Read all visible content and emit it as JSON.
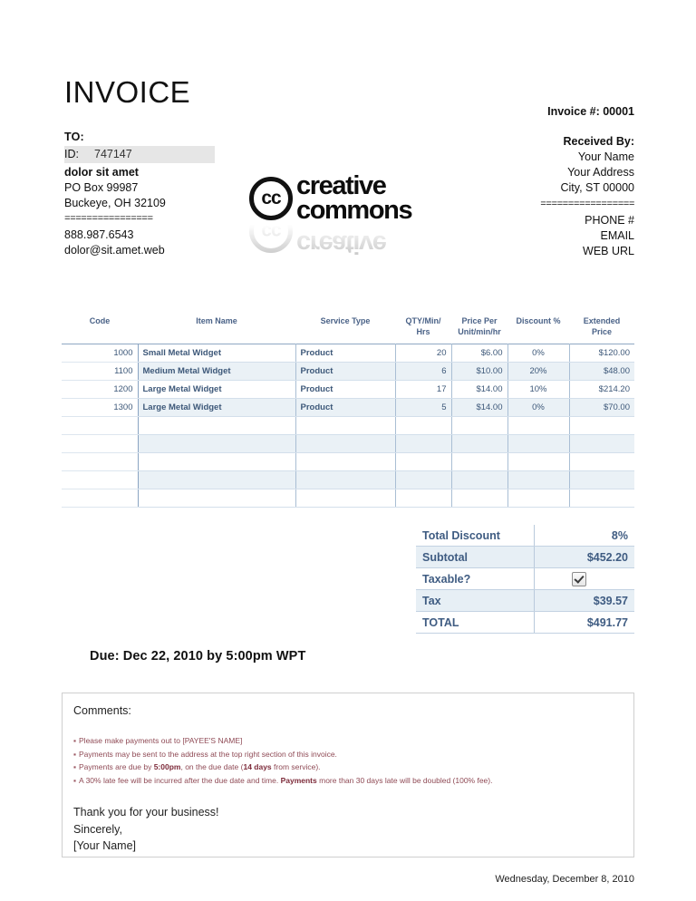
{
  "document": {
    "title": "INVOICE"
  },
  "bill_to": {
    "label": "TO:",
    "id_key": "ID:",
    "id_value": "747147",
    "name": "dolor sit amet",
    "address_line": "PO Box 99987",
    "city_state_zip": "Buckeye, OH 32109",
    "separator": "================",
    "phone": "888.987.6543",
    "email": "dolor@sit.amet.web"
  },
  "logo": {
    "badge_text": "cc",
    "line1": "creative",
    "line2": "commons"
  },
  "received_by": {
    "invoice_number_label": "Invoice #: 00001",
    "label": "Received By:",
    "name": "Your Name",
    "address": "Your Address",
    "city_state_zip": "City, ST 00000",
    "separator": "=================",
    "phone": "PHONE #",
    "email": "EMAIL",
    "web": "WEB URL"
  },
  "items_table": {
    "headers": {
      "code": "Code",
      "item_name": "Item Name",
      "service_type": "Service Type",
      "qty": "QTY/Min/ Hrs",
      "qty_l1": "QTY/Min/",
      "qty_l2": "Hrs",
      "price_l1": "Price Per",
      "price_l2": "Unit/min/hr",
      "discount": "Discount %",
      "extended_l1": "Extended",
      "extended_l2": "Price"
    },
    "rows": [
      {
        "code": "1000",
        "name": "Small Metal Widget",
        "type": "Product",
        "qty": "20",
        "price": "$6.00",
        "discount": "0%",
        "extended": "$120.00"
      },
      {
        "code": "1100",
        "name": "Medium Metal Widget",
        "type": "Product",
        "qty": "6",
        "price": "$10.00",
        "discount": "20%",
        "extended": "$48.00"
      },
      {
        "code": "1200",
        "name": "Large Metal Widget",
        "type": "Product",
        "qty": "17",
        "price": "$14.00",
        "discount": "10%",
        "extended": "$214.20"
      },
      {
        "code": "1300",
        "name": "Large Metal Widget",
        "type": "Product",
        "qty": "5",
        "price": "$14.00",
        "discount": "0%",
        "extended": "$70.00"
      },
      {
        "code": "",
        "name": "",
        "type": "",
        "qty": "",
        "price": "",
        "discount": "",
        "extended": ""
      },
      {
        "code": "",
        "name": "",
        "type": "",
        "qty": "",
        "price": "",
        "discount": "",
        "extended": ""
      },
      {
        "code": "",
        "name": "",
        "type": "",
        "qty": "",
        "price": "",
        "discount": "",
        "extended": ""
      },
      {
        "code": "",
        "name": "",
        "type": "",
        "qty": "",
        "price": "",
        "discount": "",
        "extended": ""
      },
      {
        "code": "",
        "name": "",
        "type": "",
        "qty": "",
        "price": "",
        "discount": "",
        "extended": ""
      }
    ]
  },
  "totals": {
    "total_discount_label": "Total Discount",
    "total_discount_value": "8%",
    "subtotal_label": "Subtotal",
    "subtotal_value": "$452.20",
    "taxable_label": "Taxable?",
    "taxable_checked": true,
    "tax_label": "Tax",
    "tax_value": "$39.57",
    "total_label": "TOTAL",
    "total_value": "$491.77"
  },
  "due": {
    "text": "Due: Dec 22, 2010 by 5:00pm WPT"
  },
  "comments": {
    "label": "Comments:",
    "bullet": "▪",
    "notes": [
      {
        "pre": "Please make payments out to [PAYEE'S NAME]",
        "bold": "",
        "post": ""
      },
      {
        "pre": "Payments may be sent to the address at the top right section of this invoice.",
        "bold": "",
        "post": ""
      },
      {
        "pre": "Payments are due by ",
        "bold": "5:00pm",
        "post": ", on the due date (",
        "bold2": "14 days",
        "post2": " from service)."
      },
      {
        "pre": "A 30% late fee will be incurred after the due date and time. ",
        "bold": "Payments",
        "post": " more than 30 days late will be doubled (100% fee)."
      }
    ],
    "thanks": "Thank you for your business!",
    "sincerely": "Sincerely,",
    "signature": "[Your Name]"
  },
  "footer": {
    "date": "Wednesday, December 8, 2010"
  },
  "colors": {
    "table_text": "#3d5879",
    "table_header": "#4a6287",
    "totals_text": "#3f5c82",
    "notes_text": "#8f4a55",
    "id_highlight": "#e6e6e6",
    "row_shade": "#eaf1f6"
  }
}
